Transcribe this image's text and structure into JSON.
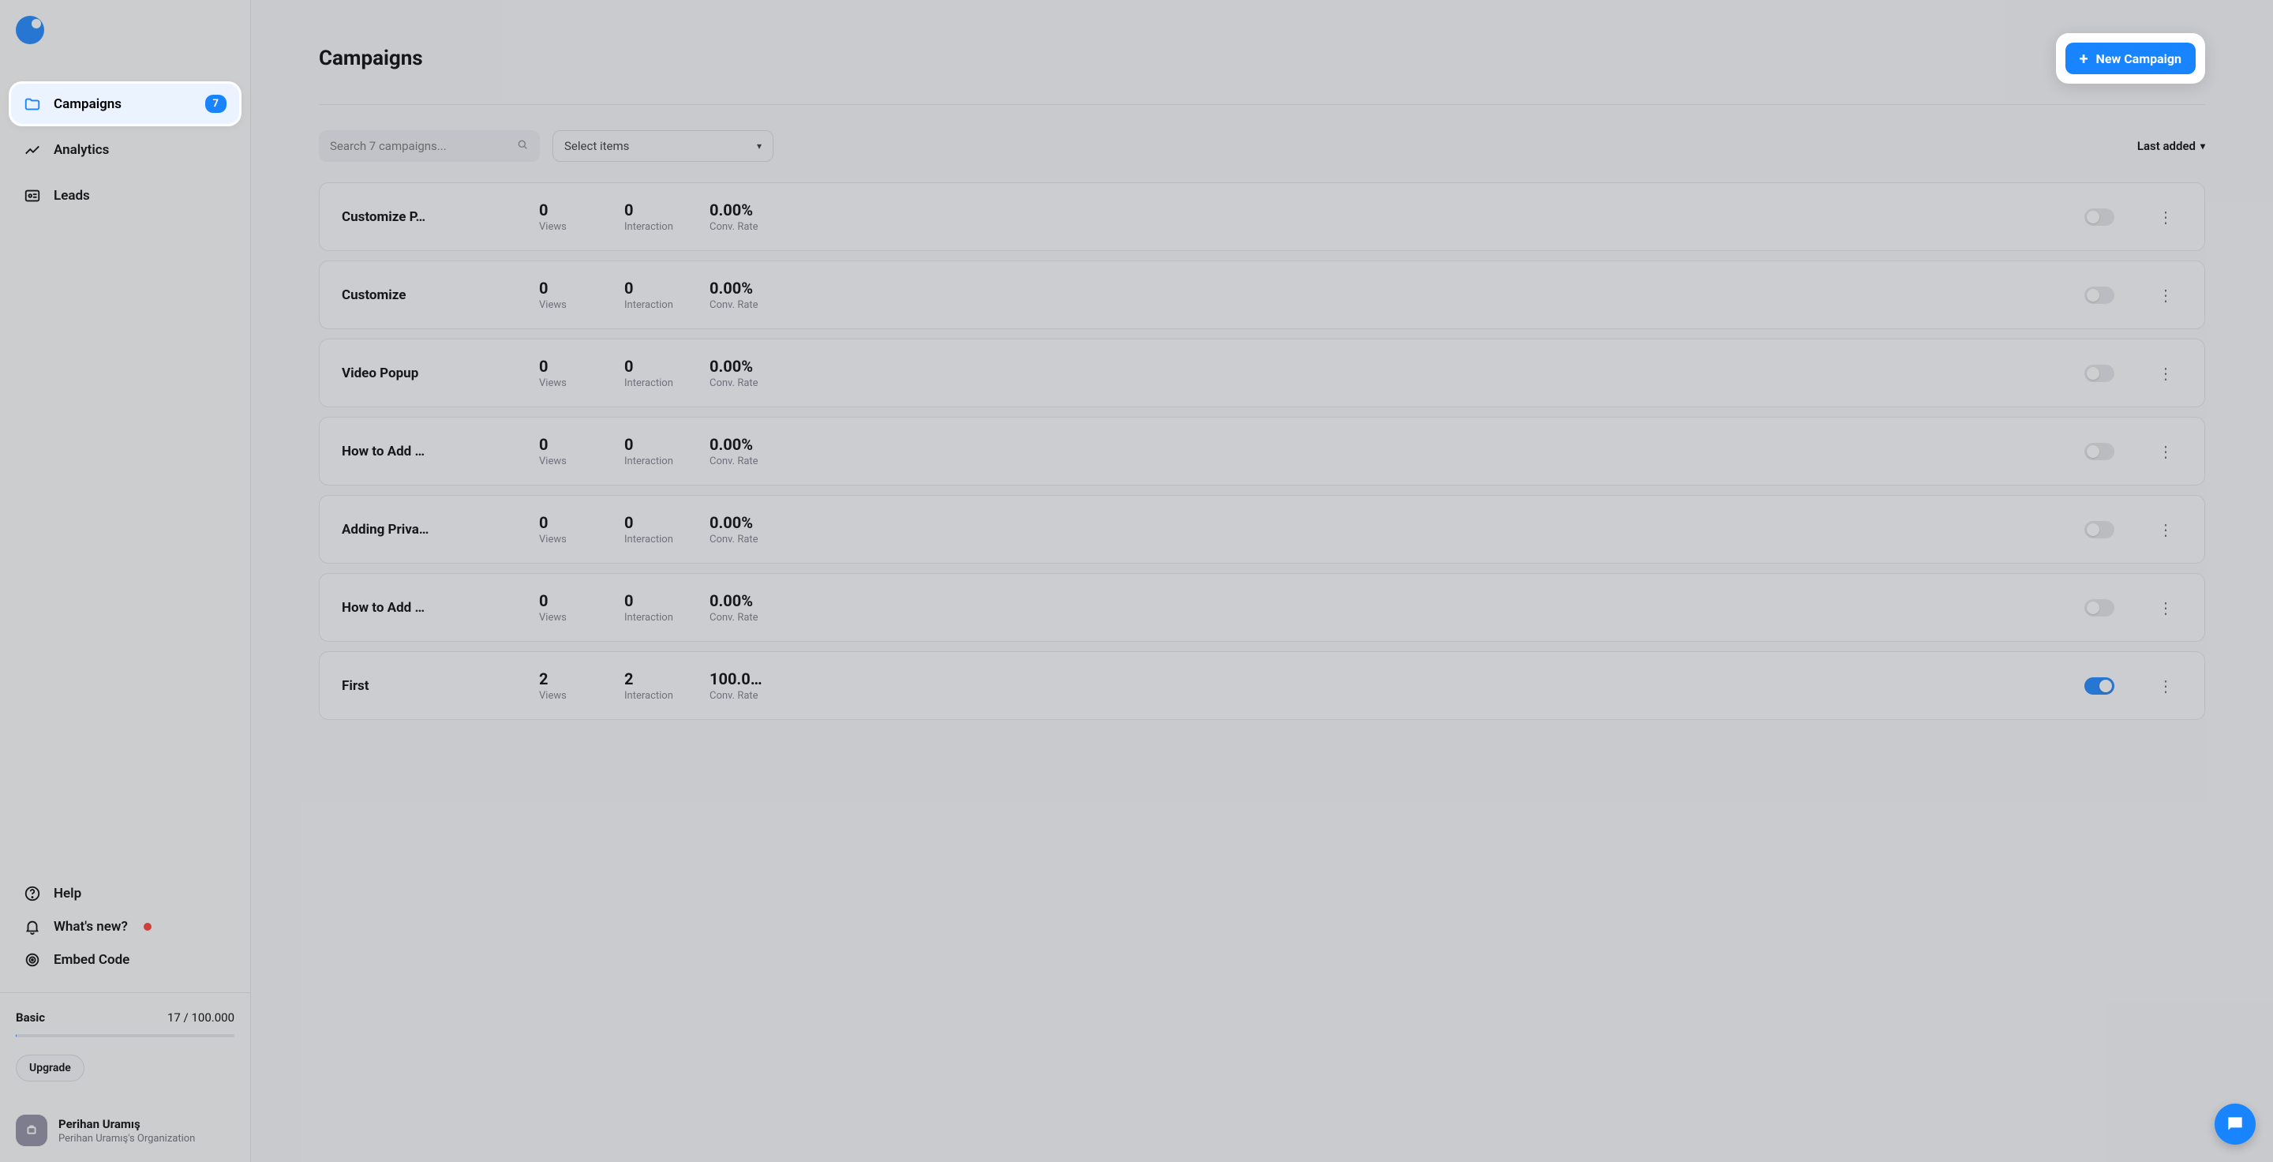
{
  "sidebar": {
    "nav": [
      {
        "label": "Campaigns",
        "icon": "folder-icon",
        "badge": "7",
        "active": true
      },
      {
        "label": "Analytics",
        "icon": "analytics-icon"
      },
      {
        "label": "Leads",
        "icon": "leads-icon"
      }
    ],
    "bottom_links": [
      {
        "label": "Help",
        "icon": "help-icon"
      },
      {
        "label": "What's new?",
        "icon": "bell-icon",
        "dot": true
      },
      {
        "label": "Embed Code",
        "icon": "target-icon"
      }
    ],
    "plan": {
      "name": "Basic",
      "usage": "17 / 100.000",
      "upgrade_label": "Upgrade"
    },
    "user": {
      "name": "Perihan Uramış",
      "org": "Perihan Uramış's Organization"
    }
  },
  "page": {
    "title": "Campaigns",
    "new_button": "New Campaign"
  },
  "toolbar": {
    "search_placeholder": "Search 7 campaigns...",
    "select_label": "Select items",
    "sort_label": "Last added"
  },
  "stat_labels": {
    "views": "Views",
    "interaction": "Interaction",
    "conv": "Conv. Rate"
  },
  "campaigns": [
    {
      "name": "Customize P…",
      "views": "0",
      "interaction": "0",
      "conv": "0.00%",
      "on": false
    },
    {
      "name": "Customize",
      "views": "0",
      "interaction": "0",
      "conv": "0.00%",
      "on": false
    },
    {
      "name": "Video Popup",
      "views": "0",
      "interaction": "0",
      "conv": "0.00%",
      "on": false
    },
    {
      "name": "How to Add …",
      "views": "0",
      "interaction": "0",
      "conv": "0.00%",
      "on": false
    },
    {
      "name": "Adding Priva…",
      "views": "0",
      "interaction": "0",
      "conv": "0.00%",
      "on": false
    },
    {
      "name": "How to Add …",
      "views": "0",
      "interaction": "0",
      "conv": "0.00%",
      "on": false
    },
    {
      "name": "First",
      "views": "2",
      "interaction": "2",
      "conv": "100.0…",
      "on": true
    }
  ]
}
